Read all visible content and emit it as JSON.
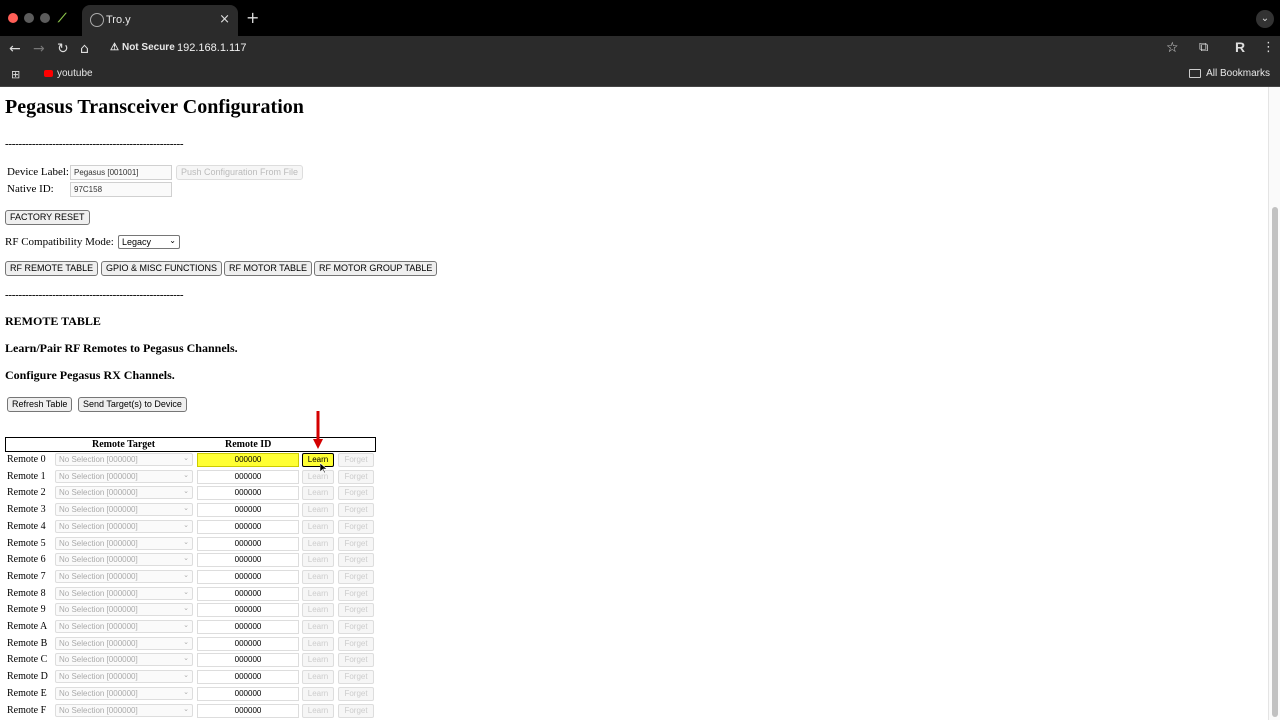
{
  "browser": {
    "tab_title": "Tro.y",
    "close_glyph": "×",
    "new_tab_glyph": "+",
    "security_label": "Not Secure",
    "url": "192.168.1.117",
    "bookmark_youtube": "youtube",
    "all_bookmarks": "All Bookmarks"
  },
  "page": {
    "title": "Pegasus Transceiver Configuration",
    "divider": "-----------------------------------------------------",
    "device_label_label": "Device Label:",
    "device_label_value": "Pegasus [001001]",
    "push_config_button": "Push Configuration From File",
    "native_id_label": "Native ID:",
    "native_id_value": "97C158",
    "factory_reset_button": "FACTORY RESET",
    "rf_mode_label": "RF Compatibility Mode:",
    "rf_mode_value": "Legacy",
    "nav_buttons": [
      "RF REMOTE TABLE",
      "GPIO & MISC FUNCTIONS",
      "RF MOTOR TABLE",
      "RF MOTOR GROUP TABLE"
    ],
    "section_title": "REMOTE TABLE",
    "subtitle1": "Learn/Pair RF Remotes to Pegasus Channels.",
    "subtitle2": "Configure Pegasus RX Channels.",
    "refresh_button": "Refresh Table",
    "send_button": "Send Target(s) to Device"
  },
  "table": {
    "col_remote_target": "Remote Target",
    "col_remote_id": "Remote ID",
    "learn_label": "Learn",
    "forget_label": "Forget",
    "target_placeholder": "No Selection [000000]",
    "rows": [
      {
        "name": "Remote 0",
        "id": "000000"
      },
      {
        "name": "Remote 1",
        "id": "000000"
      },
      {
        "name": "Remote 2",
        "id": "000000"
      },
      {
        "name": "Remote 3",
        "id": "000000"
      },
      {
        "name": "Remote 4",
        "id": "000000"
      },
      {
        "name": "Remote 5",
        "id": "000000"
      },
      {
        "name": "Remote 6",
        "id": "000000"
      },
      {
        "name": "Remote 7",
        "id": "000000"
      },
      {
        "name": "Remote 8",
        "id": "000000"
      },
      {
        "name": "Remote 9",
        "id": "000000"
      },
      {
        "name": "Remote A",
        "id": "000000"
      },
      {
        "name": "Remote B",
        "id": "000000"
      },
      {
        "name": "Remote C",
        "id": "000000"
      },
      {
        "name": "Remote D",
        "id": "000000"
      },
      {
        "name": "Remote E",
        "id": "000000"
      },
      {
        "name": "Remote F",
        "id": "000000"
      }
    ]
  },
  "colors": {
    "highlight": "#ffff33",
    "annotation_arrow": "#d40000"
  }
}
